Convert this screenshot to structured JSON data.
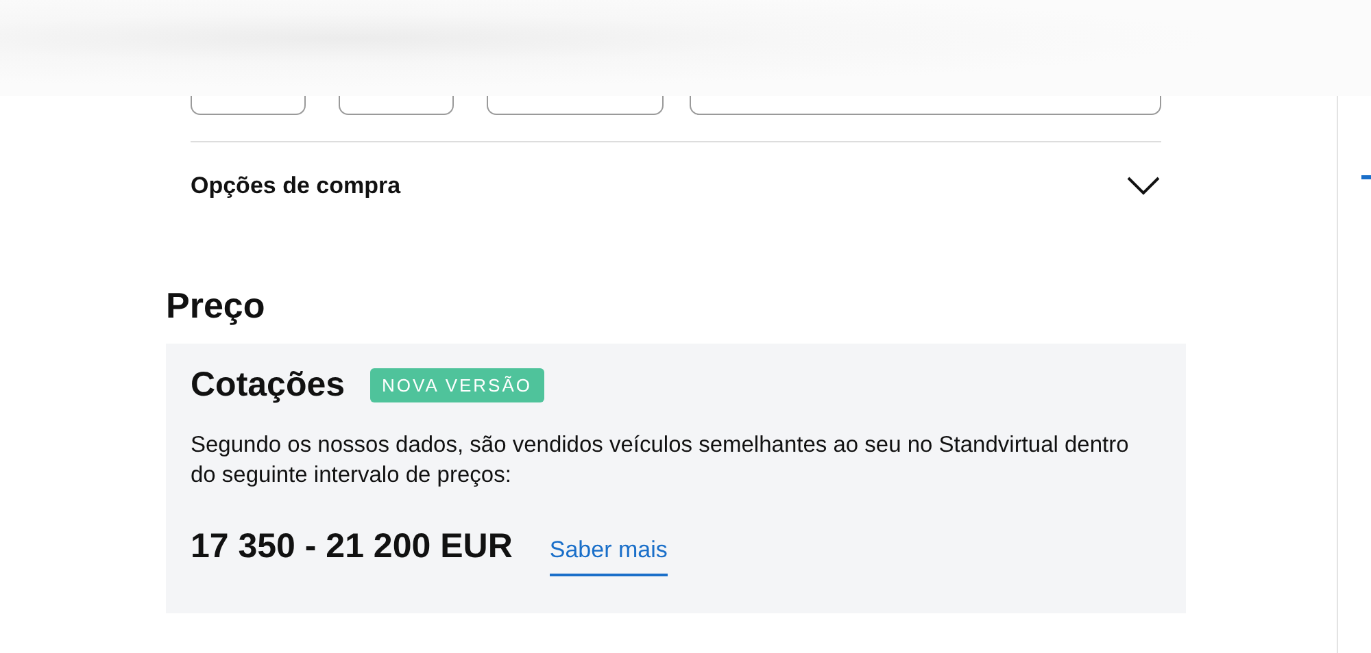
{
  "purchase_options": {
    "label": "Opções de compra",
    "expanded": false
  },
  "price_section": {
    "title": "Preço",
    "card": {
      "title": "Cotações",
      "badge": "NOVA VERSÃO",
      "description": "Segundo os nossos dados, são vendidos veículos semelhantes ao seu no Standvirtual dentro do seguinte intervalo de preços:",
      "price_range": "17 350 - 21 200 EUR",
      "link": "Saber mais"
    }
  }
}
